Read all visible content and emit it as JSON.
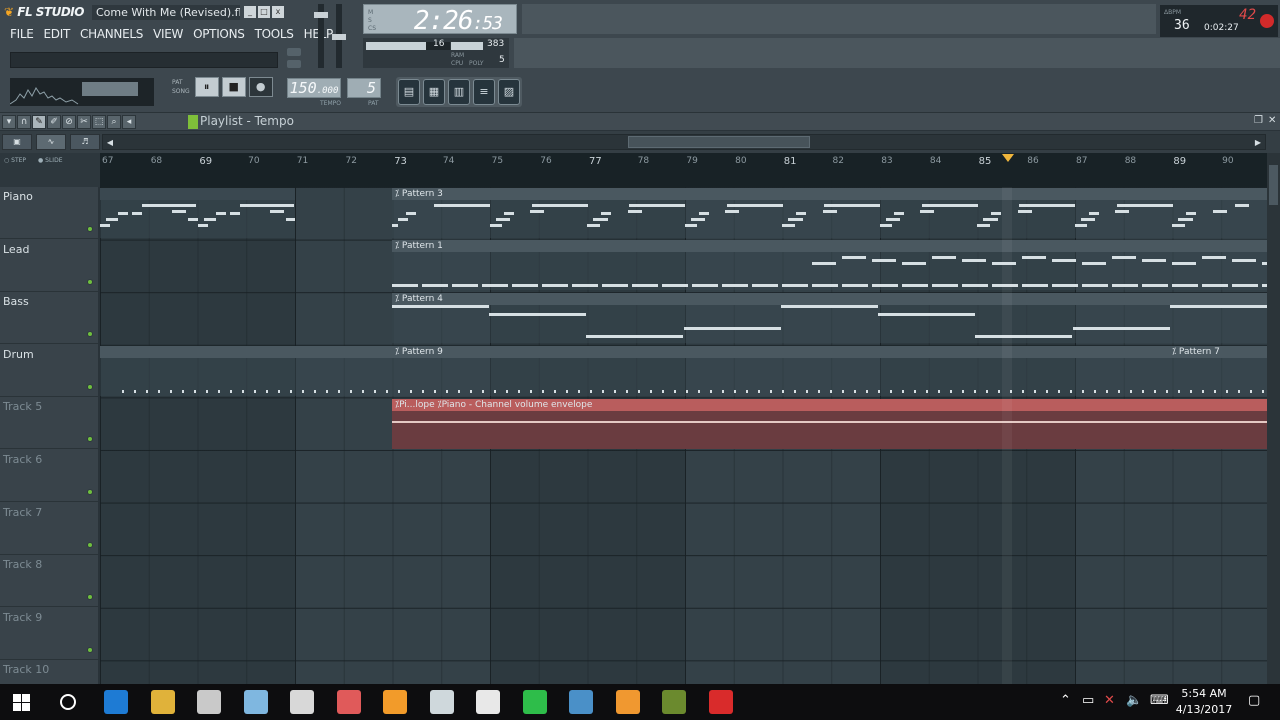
{
  "app": {
    "logo_text": "FL STUDIO",
    "file_name": "Come With Me (Revised).flp",
    "window_buttons": [
      "_",
      "□",
      "x"
    ]
  },
  "menu": [
    "FILE",
    "EDIT",
    "CHANNELS",
    "VIEW",
    "OPTIONS",
    "TOOLS",
    "HELP"
  ],
  "time_display": {
    "time": "2:26",
    "sub": ":53",
    "label_m": "M",
    "label_s": "S",
    "label_cs": "CS"
  },
  "cpu_panel": {
    "cpu_value": "16",
    "mem_value": "383",
    "poly_value": "5",
    "cpu_label": "CPU",
    "poly_label": "POLY",
    "mem_label": "RAM",
    "cpu_fraction": 0.72
  },
  "record_counter": {
    "top_label": "ΔBPM",
    "value": "36",
    "red": "42",
    "time": "0:02:27"
  },
  "transport": {
    "pat_label": "PAT",
    "song_label": "SONG",
    "pause": "⏸",
    "stop": "■",
    "record": "●"
  },
  "tempo": {
    "value": "150",
    "decimal": ".000",
    "label": "TEMPO"
  },
  "pattern": {
    "value": "5",
    "label": "PAT"
  },
  "view_buttons": [
    "▤",
    "▦",
    "▥",
    "≡",
    "▨"
  ],
  "playlist": {
    "title": "Playlist - Tempo",
    "snap_options": [
      "STEP",
      "SLIDE"
    ],
    "bar_numbers": [
      "67",
      "68",
      "69",
      "70",
      "71",
      "72",
      "73",
      "74",
      "75",
      "76",
      "77",
      "78",
      "79",
      "80",
      "81",
      "82",
      "83",
      "84",
      "85",
      "86",
      "87",
      "88",
      "89",
      "90"
    ],
    "major_bars": [
      "69",
      "73",
      "77",
      "81",
      "85",
      "89"
    ],
    "tracks": [
      {
        "name": "Piano",
        "active": true
      },
      {
        "name": "Lead",
        "active": true
      },
      {
        "name": "Bass",
        "active": true
      },
      {
        "name": "Drum",
        "active": true
      },
      {
        "name": "Track 5",
        "active": false
      },
      {
        "name": "Track 6",
        "active": false
      },
      {
        "name": "Track 7",
        "active": false
      },
      {
        "name": "Track 8",
        "active": false
      },
      {
        "name": "Track 9",
        "active": false
      },
      {
        "name": "Track 10",
        "active": false
      }
    ],
    "clips": {
      "piano": "Pattern 3",
      "lead": "Pattern 1",
      "bass": "Pattern 4",
      "drum_a": "Pattern 9",
      "drum_b": "Pattern 7",
      "env_a": "Pi...lope",
      "env_b": "Piano - Channel volume envelope"
    }
  },
  "taskbar": {
    "time": "5:54 AM",
    "date": "4/13/2017",
    "icons": [
      "edge-icon",
      "file-explorer-icon",
      "fl-fox-icon",
      "app-icon",
      "calculator-icon",
      "red-app-icon",
      "orange-app-icon",
      "user-app-icon",
      "people-icon",
      "line-icon",
      "photos-icon",
      "media-player-icon",
      "fl-studio-icon",
      "record-app-icon"
    ]
  },
  "colors": {
    "header_bg": "#3d474e",
    "grid_bg": "#344148",
    "envelope_clip": "#b95d5d",
    "accent_green": "#7fbf3a",
    "playhead": "#f0b63c"
  }
}
